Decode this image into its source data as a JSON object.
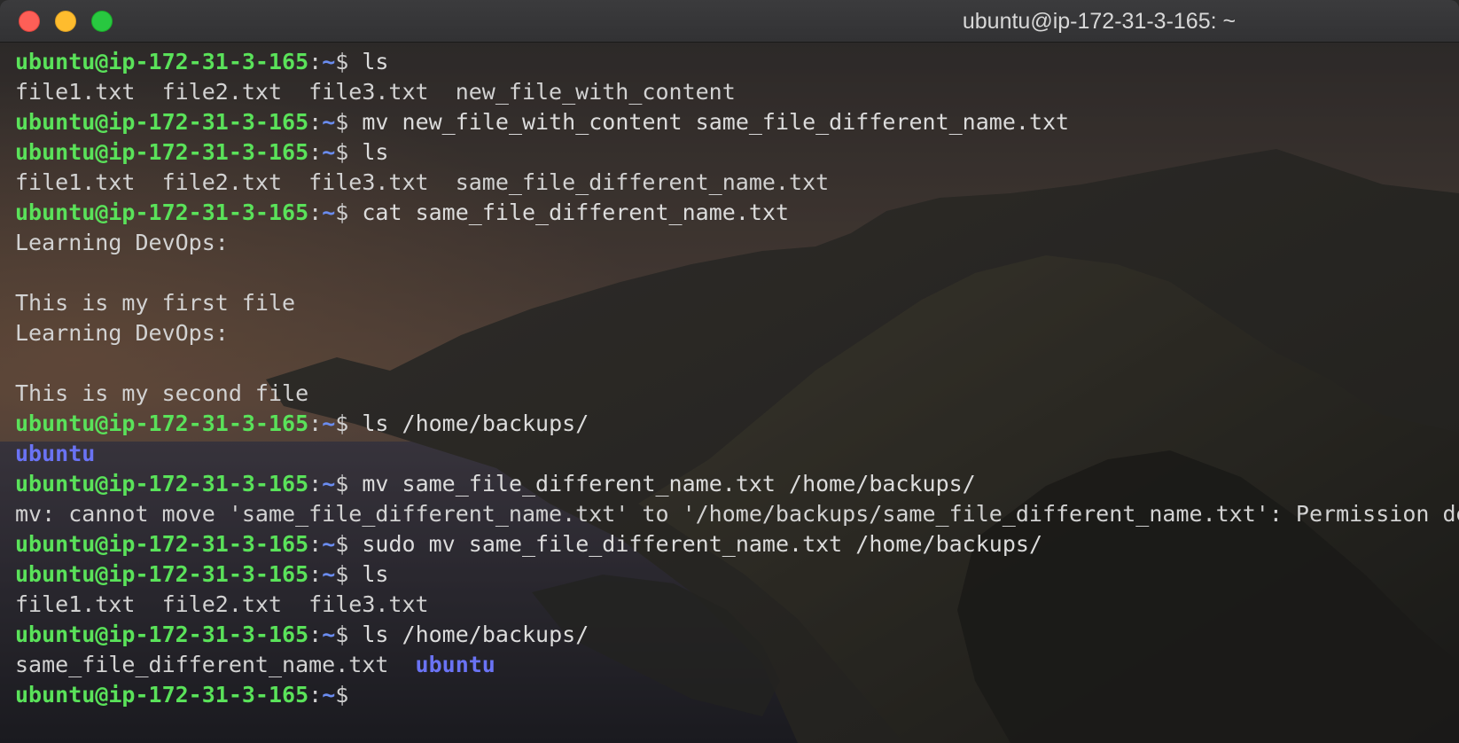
{
  "window": {
    "title": "ubuntu@ip-172-31-3-165: ~"
  },
  "prompt": {
    "user_host": "ubuntu@ip-172-31-3-165",
    "separator": ":",
    "path": "~",
    "symbol": "$"
  },
  "lines": [
    {
      "type": "prompt",
      "cmd": " ls"
    },
    {
      "type": "output",
      "text": "file1.txt  file2.txt  file3.txt  new_file_with_content"
    },
    {
      "type": "prompt",
      "cmd": " mv new_file_with_content same_file_different_name.txt"
    },
    {
      "type": "prompt",
      "cmd": " ls"
    },
    {
      "type": "output",
      "text": "file1.txt  file2.txt  file3.txt  same_file_different_name.txt"
    },
    {
      "type": "prompt",
      "cmd": " cat same_file_different_name.txt"
    },
    {
      "type": "output",
      "text": "Learning DevOps:"
    },
    {
      "type": "output",
      "text": ""
    },
    {
      "type": "output",
      "text": "This is my first file"
    },
    {
      "type": "output",
      "text": "Learning DevOps:"
    },
    {
      "type": "output",
      "text": ""
    },
    {
      "type": "output",
      "text": "This is my second file"
    },
    {
      "type": "prompt",
      "cmd": " ls /home/backups/"
    },
    {
      "type": "output_parts",
      "parts": [
        {
          "text": "ubuntu",
          "style": "dir"
        }
      ]
    },
    {
      "type": "prompt",
      "cmd": " mv same_file_different_name.txt /home/backups/"
    },
    {
      "type": "output",
      "text": "mv: cannot move 'same_file_different_name.txt' to '/home/backups/same_file_different_name.txt': Permission denied"
    },
    {
      "type": "prompt",
      "cmd": " sudo mv same_file_different_name.txt /home/backups/"
    },
    {
      "type": "prompt",
      "cmd": " ls"
    },
    {
      "type": "output",
      "text": "file1.txt  file2.txt  file3.txt"
    },
    {
      "type": "prompt",
      "cmd": " ls /home/backups/"
    },
    {
      "type": "output_parts",
      "parts": [
        {
          "text": "same_file_different_name.txt  ",
          "style": "out"
        },
        {
          "text": "ubuntu",
          "style": "dir"
        }
      ]
    },
    {
      "type": "prompt",
      "cmd": ""
    }
  ],
  "colors": {
    "prompt_user": "#5ae25a",
    "prompt_path": "#6a8cf0",
    "directory": "#6a73f4",
    "text": "#d4d4d4",
    "close": "#fe5f57",
    "minimize": "#febc2e",
    "maximize": "#28c840"
  },
  "icons": [
    "close-button",
    "minimize-button",
    "maximize-button"
  ]
}
